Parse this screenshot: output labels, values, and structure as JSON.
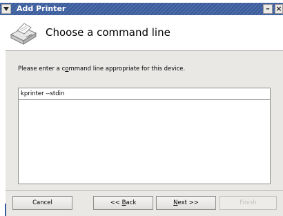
{
  "window": {
    "title": "Add Printer"
  },
  "header": {
    "title": "Choose a command line"
  },
  "main": {
    "prompt_pre": "Please enter a c",
    "prompt_accel": "o",
    "prompt_post": "mmand line appropriate for this device.",
    "command_value": "kprinter --stdin"
  },
  "buttons": {
    "cancel": "Cancel",
    "back_pre": "<< ",
    "back_accel": "B",
    "back_post": "ack",
    "next_accel": "N",
    "next_post": "ext >>",
    "finish": "Finish"
  },
  "icons": {
    "menu": "chevron-down-icon",
    "minimize": "minimize-icon",
    "close": "close-icon",
    "printer": "printer-icon"
  },
  "colors": {
    "titlebar": "#3a5a98",
    "content_bg": "#eae8e4"
  }
}
